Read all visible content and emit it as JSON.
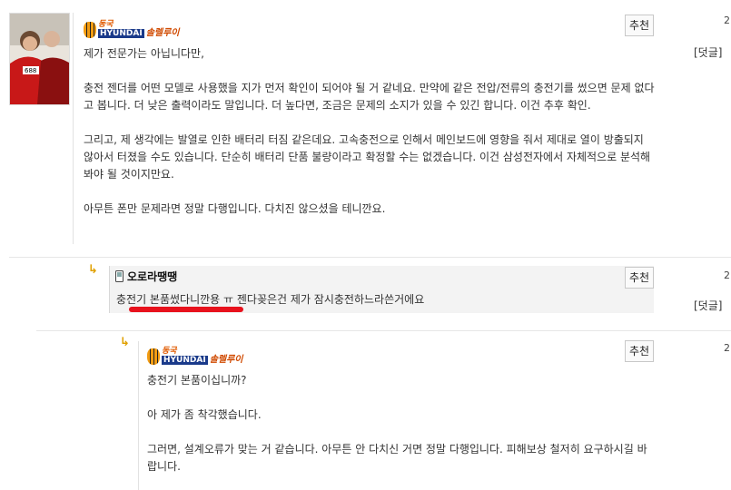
{
  "comment1": {
    "logo_top": "동국",
    "logo_brand": "HYUNDAI",
    "logo_bottom": "솔렐루이",
    "recommend_label": "추천",
    "reply_label": "[덧글]",
    "side_number": "2",
    "paragraphs": [
      "제가 전문가는 아닙니다만,",
      "충전 젠더를 어떤 모델로 사용했을 지가 먼저 확인이 되어야 될 거 같네요. 만약에 같은 전압/전류의 충전기를 썼으면 문제 없다고 봅니다. 더 낮은 출력이라도 말입니다. 더 높다면, 조금은 문제의 소지가 있을 수 있긴 합니다. 이건 추후 확인.",
      "그리고, 제 생각에는 발열로 인한 배터리 터짐 같은데요. 고속충전으로 인해서 메인보드에 영향을 줘서 제대로 열이 방출되지 않아서 터졌을 수도 있습니다. 단순히 배터리 단품 불량이라고 확정할 수는 없겠습니다. 이건 삼성전자에서 자체적으로 분석해봐야 될 것이지만요.",
      "아무튼 폰만 문제라면 정말 다행입니다. 다치진 않으셨을 테니깐요."
    ]
  },
  "comment2": {
    "author": "오로라땡땡",
    "recommend_label": "추천",
    "reply_label": "[덧글]",
    "side_number": "2",
    "text_underlined": "충전기 본품썼다니깐용",
    "text_rest": " ㅠ 젠다꽂은건 제가 잠시충전하느라쓴거에요"
  },
  "comment3": {
    "logo_top": "동국",
    "logo_brand": "HYUNDAI",
    "logo_bottom": "솔렐루이",
    "recommend_label": "추천",
    "side_number": "2",
    "paragraphs": [
      "충전기 본품이십니까?",
      "아 제가 좀 착각했습니다.",
      "그러면, 설계오류가 맞는 거 같습니다. 아무튼 안 다치신 거면 정말 다행입니다. 피해보상 철저히 요구하시길 바랍니다."
    ]
  },
  "colors": {
    "underline": "#e8121d",
    "reply_arrow": "#e0a000"
  },
  "icons": {
    "reply_arrow": "reply-arrow-icon",
    "phone": "mobile-phone-icon"
  }
}
